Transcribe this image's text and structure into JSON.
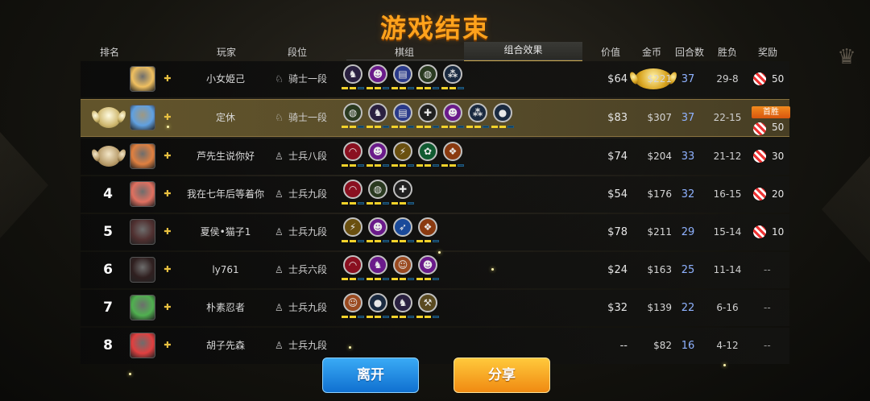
{
  "title": "游戏结束",
  "headers": {
    "rank": "排名",
    "player": "玩家",
    "tier": "段位",
    "pieces": "棋组",
    "combo": "组合效果",
    "value": "价值",
    "gold": "金币",
    "rounds": "回合数",
    "winloss": "胜负",
    "reward": "奖励"
  },
  "first_win_label": "首胜",
  "rows": [
    {
      "rank": "",
      "medal": "gold",
      "player": "小女姫己",
      "tier": "骑士一段",
      "tier_icon": "knight-icon",
      "value": "$64",
      "gold": "$221",
      "rounds": "37",
      "wl": "29-8",
      "reward": "50",
      "pieces": [
        {
          "color": "#2a2040",
          "border": "#c0c0c0",
          "glyph": "♞"
        },
        {
          "color": "#6a1a8a",
          "border": "#c0c0c0",
          "glyph": "☻"
        },
        {
          "color": "#2a3a8a",
          "border": "#c0c0c0",
          "glyph": "▤"
        },
        {
          "color": "#2a3a20",
          "border": "#c0c0c0",
          "glyph": "◍"
        },
        {
          "color": "#1a2a40",
          "border": "#c0c0c0",
          "glyph": "⁂"
        }
      ]
    },
    {
      "rank": "",
      "medal": "silver",
      "player": "定休",
      "tier": "骑士一段",
      "tier_icon": "knight-icon",
      "value": "$83",
      "gold": "$307",
      "rounds": "37",
      "wl": "22-15",
      "reward": "50",
      "first_win": true,
      "pieces": [
        {
          "color": "#2a3a20",
          "border": "#c0c0c0",
          "glyph": "◍"
        },
        {
          "color": "#2a2040",
          "border": "#c0c0c0",
          "glyph": "♞"
        },
        {
          "color": "#2a3a8a",
          "border": "#c0c0c0",
          "glyph": "▤"
        },
        {
          "color": "#202020",
          "border": "#c0c0c0",
          "glyph": "✚"
        },
        {
          "color": "#6a1a8a",
          "border": "#c0c0c0",
          "glyph": "☻"
        },
        {
          "color": "#1a2a40",
          "border": "#c0c0c0",
          "glyph": "⁂"
        },
        {
          "color": "#1a2a40",
          "border": "#c0c0c0",
          "glyph": "●"
        }
      ]
    },
    {
      "rank": "",
      "medal": "bronze",
      "player": "芦先生说你好",
      "tier": "士兵八段",
      "tier_icon": "pawn-icon",
      "value": "$74",
      "gold": "$204",
      "rounds": "33",
      "wl": "21-12",
      "reward": "30",
      "pieces": [
        {
          "color": "#8a1020",
          "border": "#c0c0c0",
          "glyph": "◠"
        },
        {
          "color": "#6a1a8a",
          "border": "#c0c0c0",
          "glyph": "☻"
        },
        {
          "color": "#6a5010",
          "border": "#c0c0c0",
          "glyph": "⚡"
        },
        {
          "color": "#105a30",
          "border": "#c0c0c0",
          "glyph": "✿"
        },
        {
          "color": "#8a3a10",
          "border": "#c0c0c0",
          "glyph": "❖"
        }
      ]
    },
    {
      "rank": "4",
      "player": "我在七年后等着你",
      "tier": "士兵九段",
      "tier_icon": "pawn-icon",
      "value": "$54",
      "gold": "$176",
      "rounds": "32",
      "wl": "16-15",
      "reward": "20",
      "pieces": [
        {
          "color": "#8a1020",
          "border": "#c0c0c0",
          "glyph": "◠"
        },
        {
          "color": "#2a3a20",
          "border": "#c0c0c0",
          "glyph": "◍"
        },
        {
          "color": "#202020",
          "border": "#c0c0c0",
          "glyph": "✚"
        }
      ]
    },
    {
      "rank": "5",
      "player": "夏侯•猫子1",
      "tier": "士兵九段",
      "tier_icon": "pawn-icon",
      "value": "$78",
      "gold": "$211",
      "rounds": "29",
      "wl": "15-14",
      "reward": "10",
      "pieces": [
        {
          "color": "#6a5010",
          "border": "#c0c0c0",
          "glyph": "⚡"
        },
        {
          "color": "#6a1a8a",
          "border": "#c0c0c0",
          "glyph": "☻"
        },
        {
          "color": "#1a4a9a",
          "border": "#c0c0c0",
          "glyph": "➶"
        },
        {
          "color": "#8a3a10",
          "border": "#c0c0c0",
          "glyph": "❖"
        }
      ]
    },
    {
      "rank": "6",
      "player": "ly761",
      "tier": "士兵六段",
      "tier_icon": "pawn-icon",
      "value": "$24",
      "gold": "$163",
      "rounds": "25",
      "wl": "11-14",
      "reward": "--",
      "pieces": [
        {
          "color": "#8a1020",
          "border": "#c0c0c0",
          "glyph": "◠"
        },
        {
          "color": "#6a1a8a",
          "border": "#c0c0c0",
          "glyph": "♞"
        },
        {
          "color": "#9a4a20",
          "border": "#c0c0c0",
          "glyph": "☺"
        },
        {
          "color": "#6a1a8a",
          "border": "#c0c0c0",
          "glyph": "☻"
        }
      ]
    },
    {
      "rank": "7",
      "player": "朴素忍者",
      "tier": "士兵九段",
      "tier_icon": "pawn-icon",
      "value": "$32",
      "gold": "$139",
      "rounds": "22",
      "wl": "6-16",
      "reward": "--",
      "pieces": [
        {
          "color": "#9a4a20",
          "border": "#c0c0c0",
          "glyph": "☺"
        },
        {
          "color": "#1a2a40",
          "border": "#c0c0c0",
          "glyph": "●"
        },
        {
          "color": "#2a2040",
          "border": "#c0c0c0",
          "glyph": "♞"
        },
        {
          "color": "#5a4a20",
          "border": "#c0c0c0",
          "glyph": "⚒"
        }
      ]
    },
    {
      "rank": "8",
      "player": "胡子先森",
      "tier": "士兵九段",
      "tier_icon": "pawn-icon",
      "value": "--",
      "gold": "$82",
      "rounds": "16",
      "wl": "4-12",
      "reward": "--",
      "pieces": []
    }
  ],
  "bar_patterns": [
    [
      [
        1,
        1,
        0
      ],
      [
        1,
        1,
        0
      ],
      [
        1,
        1,
        0
      ],
      [
        1,
        1,
        0
      ],
      [
        1,
        1,
        0
      ]
    ],
    [
      [
        1,
        1,
        0
      ],
      [
        1,
        1,
        0
      ],
      [
        1,
        1,
        0
      ],
      [
        1,
        1,
        0
      ],
      [
        1,
        1,
        0
      ],
      [
        1,
        1,
        0
      ],
      [
        1,
        1,
        0
      ]
    ],
    [
      [
        1,
        1,
        0
      ],
      [
        1,
        1,
        0
      ],
      [
        1,
        1,
        0
      ],
      [
        1,
        1,
        0
      ],
      [
        1,
        1,
        0
      ]
    ],
    [
      [
        1,
        1,
        0
      ],
      [
        1,
        1,
        0
      ],
      [
        1,
        1,
        0
      ]
    ],
    [
      [
        1,
        1,
        0
      ],
      [
        1,
        1,
        0
      ],
      [
        1,
        1,
        0
      ],
      [
        1,
        1,
        0
      ]
    ],
    [
      [
        1,
        1,
        0
      ],
      [
        1,
        1,
        0
      ],
      [
        1,
        1,
        0
      ],
      [
        1,
        1,
        0
      ]
    ],
    [
      [
        1,
        1,
        0
      ],
      [
        1,
        1,
        0
      ],
      [
        1,
        1,
        0
      ],
      [
        1,
        1,
        0
      ]
    ],
    []
  ],
  "avatars": [
    "#f0c060",
    "#60a0e0",
    "#e08040",
    "#e07060",
    "#503030",
    "#302020",
    "#50b050",
    "#e04040"
  ],
  "buttons": {
    "leave": "离开",
    "share": "分享"
  },
  "colors": {
    "accent": "#ffa21c",
    "first_win": "#f28b1e"
  }
}
